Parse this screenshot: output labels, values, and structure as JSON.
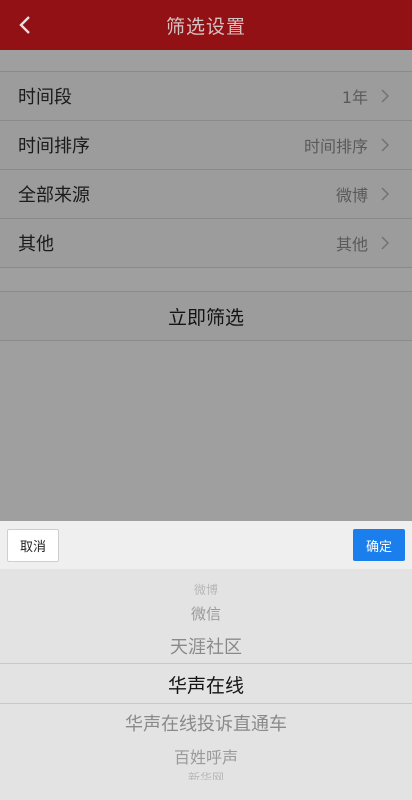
{
  "header": {
    "title": "筛选设置",
    "back_icon": "chevron-left-icon"
  },
  "rows": [
    {
      "label": "时间段",
      "value": "1年"
    },
    {
      "label": "时间排序",
      "value": "时间排序"
    },
    {
      "label": "全部来源",
      "value": "微博"
    },
    {
      "label": "其他",
      "value": "其他"
    }
  ],
  "filter_button": "立即筛选",
  "picker": {
    "cancel": "取消",
    "confirm": "确定",
    "options": [
      "微博",
      "微信",
      "天涯社区",
      "华声在线",
      "华声在线投诉直通车",
      "百姓呼声",
      "新华网"
    ],
    "selected": "华声在线"
  },
  "colors": {
    "header_bg": "#921115",
    "confirm_bg": "#1a7fec"
  }
}
